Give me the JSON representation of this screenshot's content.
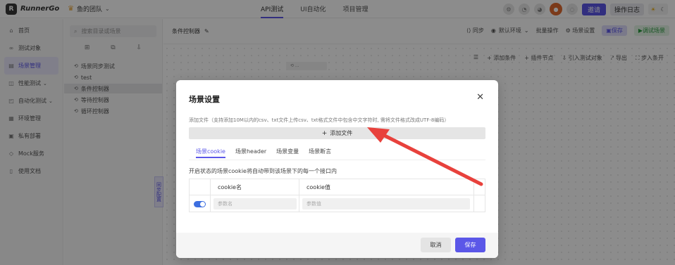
{
  "app": {
    "logo_text": "RunnerGo",
    "team_name": "鱼的团队"
  },
  "nav": {
    "tabs": [
      "API测试",
      "UI自动化",
      "项目管理"
    ]
  },
  "topbar": {
    "invite_label": "邀请",
    "log_label": "操作日志"
  },
  "sidebar": {
    "items": [
      {
        "label": "首页"
      },
      {
        "label": "测试对象"
      },
      {
        "label": "场景管理"
      },
      {
        "label": "性能测试"
      },
      {
        "label": "自动化测试"
      },
      {
        "label": "环境管理"
      },
      {
        "label": "私有部署"
      },
      {
        "label": "Mock服务"
      },
      {
        "label": "使用文档"
      }
    ]
  },
  "tree": {
    "search_placeholder": "搜索目录或场景",
    "items": [
      {
        "label": "场景同步测试"
      },
      {
        "label": "test"
      },
      {
        "label": "条件控制器"
      },
      {
        "label": "等待控制器"
      },
      {
        "label": "循环控制器"
      }
    ]
  },
  "main": {
    "scene_title": "条件控制器",
    "sync_label": "同步",
    "env_label": "默认环境",
    "batch_label": "批量操作",
    "scene_setting_label": "场景设置",
    "save_label": "保存",
    "debug_label": "调试场景",
    "toolbar": [
      "添加条件",
      "插件节点",
      "引入测试对象",
      "导出",
      "步入条开"
    ],
    "side_tab_label": "同步配置"
  },
  "modal": {
    "title": "场景设置",
    "upload_hint": "添加文件（支持添加10M以内的csv、txt文件上传csv、txt格式文件中包含中文字符时, 需将文件格式改成UTF-8编码）",
    "add_file_label": "添加文件",
    "tabs": [
      "场景cookie",
      "场景header",
      "场景变量",
      "场景断言"
    ],
    "tab_desc": "开启状态的场景cookie将自动带到该场景下的每一个接口内",
    "table": {
      "col_name": "cookie名",
      "col_value": "cookie值",
      "name_placeholder": "参数名",
      "value_placeholder": "参数值",
      "enabled": true
    },
    "cancel_label": "取消",
    "save_label": "保存"
  },
  "colors": {
    "accent": "#5b57e8",
    "arrow": "#e8413c",
    "toggle_on": "#3d6fe0"
  }
}
